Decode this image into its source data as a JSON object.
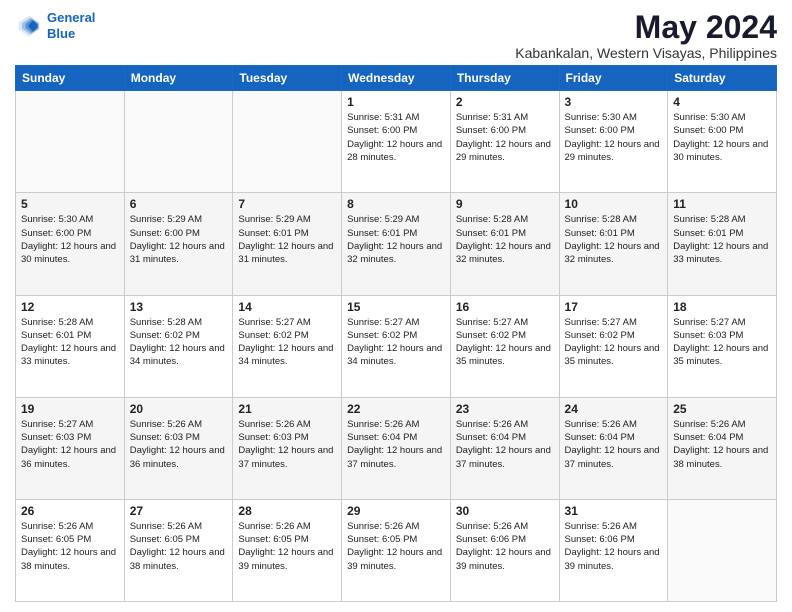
{
  "header": {
    "logo_line1": "General",
    "logo_line2": "Blue",
    "title": "May 2024",
    "subtitle": "Kabankalan, Western Visayas, Philippines"
  },
  "weekdays": [
    "Sunday",
    "Monday",
    "Tuesday",
    "Wednesday",
    "Thursday",
    "Friday",
    "Saturday"
  ],
  "weeks": [
    [
      {
        "day": "",
        "info": ""
      },
      {
        "day": "",
        "info": ""
      },
      {
        "day": "",
        "info": ""
      },
      {
        "day": "1",
        "info": "Sunrise: 5:31 AM\nSunset: 6:00 PM\nDaylight: 12 hours\nand 28 minutes."
      },
      {
        "day": "2",
        "info": "Sunrise: 5:31 AM\nSunset: 6:00 PM\nDaylight: 12 hours\nand 29 minutes."
      },
      {
        "day": "3",
        "info": "Sunrise: 5:30 AM\nSunset: 6:00 PM\nDaylight: 12 hours\nand 29 minutes."
      },
      {
        "day": "4",
        "info": "Sunrise: 5:30 AM\nSunset: 6:00 PM\nDaylight: 12 hours\nand 30 minutes."
      }
    ],
    [
      {
        "day": "5",
        "info": "Sunrise: 5:30 AM\nSunset: 6:00 PM\nDaylight: 12 hours\nand 30 minutes."
      },
      {
        "day": "6",
        "info": "Sunrise: 5:29 AM\nSunset: 6:00 PM\nDaylight: 12 hours\nand 31 minutes."
      },
      {
        "day": "7",
        "info": "Sunrise: 5:29 AM\nSunset: 6:01 PM\nDaylight: 12 hours\nand 31 minutes."
      },
      {
        "day": "8",
        "info": "Sunrise: 5:29 AM\nSunset: 6:01 PM\nDaylight: 12 hours\nand 32 minutes."
      },
      {
        "day": "9",
        "info": "Sunrise: 5:28 AM\nSunset: 6:01 PM\nDaylight: 12 hours\nand 32 minutes."
      },
      {
        "day": "10",
        "info": "Sunrise: 5:28 AM\nSunset: 6:01 PM\nDaylight: 12 hours\nand 32 minutes."
      },
      {
        "day": "11",
        "info": "Sunrise: 5:28 AM\nSunset: 6:01 PM\nDaylight: 12 hours\nand 33 minutes."
      }
    ],
    [
      {
        "day": "12",
        "info": "Sunrise: 5:28 AM\nSunset: 6:01 PM\nDaylight: 12 hours\nand 33 minutes."
      },
      {
        "day": "13",
        "info": "Sunrise: 5:28 AM\nSunset: 6:02 PM\nDaylight: 12 hours\nand 34 minutes."
      },
      {
        "day": "14",
        "info": "Sunrise: 5:27 AM\nSunset: 6:02 PM\nDaylight: 12 hours\nand 34 minutes."
      },
      {
        "day": "15",
        "info": "Sunrise: 5:27 AM\nSunset: 6:02 PM\nDaylight: 12 hours\nand 34 minutes."
      },
      {
        "day": "16",
        "info": "Sunrise: 5:27 AM\nSunset: 6:02 PM\nDaylight: 12 hours\nand 35 minutes."
      },
      {
        "day": "17",
        "info": "Sunrise: 5:27 AM\nSunset: 6:02 PM\nDaylight: 12 hours\nand 35 minutes."
      },
      {
        "day": "18",
        "info": "Sunrise: 5:27 AM\nSunset: 6:03 PM\nDaylight: 12 hours\nand 35 minutes."
      }
    ],
    [
      {
        "day": "19",
        "info": "Sunrise: 5:27 AM\nSunset: 6:03 PM\nDaylight: 12 hours\nand 36 minutes."
      },
      {
        "day": "20",
        "info": "Sunrise: 5:26 AM\nSunset: 6:03 PM\nDaylight: 12 hours\nand 36 minutes."
      },
      {
        "day": "21",
        "info": "Sunrise: 5:26 AM\nSunset: 6:03 PM\nDaylight: 12 hours\nand 37 minutes."
      },
      {
        "day": "22",
        "info": "Sunrise: 5:26 AM\nSunset: 6:04 PM\nDaylight: 12 hours\nand 37 minutes."
      },
      {
        "day": "23",
        "info": "Sunrise: 5:26 AM\nSunset: 6:04 PM\nDaylight: 12 hours\nand 37 minutes."
      },
      {
        "day": "24",
        "info": "Sunrise: 5:26 AM\nSunset: 6:04 PM\nDaylight: 12 hours\nand 37 minutes."
      },
      {
        "day": "25",
        "info": "Sunrise: 5:26 AM\nSunset: 6:04 PM\nDaylight: 12 hours\nand 38 minutes."
      }
    ],
    [
      {
        "day": "26",
        "info": "Sunrise: 5:26 AM\nSunset: 6:05 PM\nDaylight: 12 hours\nand 38 minutes."
      },
      {
        "day": "27",
        "info": "Sunrise: 5:26 AM\nSunset: 6:05 PM\nDaylight: 12 hours\nand 38 minutes."
      },
      {
        "day": "28",
        "info": "Sunrise: 5:26 AM\nSunset: 6:05 PM\nDaylight: 12 hours\nand 39 minutes."
      },
      {
        "day": "29",
        "info": "Sunrise: 5:26 AM\nSunset: 6:05 PM\nDaylight: 12 hours\nand 39 minutes."
      },
      {
        "day": "30",
        "info": "Sunrise: 5:26 AM\nSunset: 6:06 PM\nDaylight: 12 hours\nand 39 minutes."
      },
      {
        "day": "31",
        "info": "Sunrise: 5:26 AM\nSunset: 6:06 PM\nDaylight: 12 hours\nand 39 minutes."
      },
      {
        "day": "",
        "info": ""
      }
    ]
  ]
}
